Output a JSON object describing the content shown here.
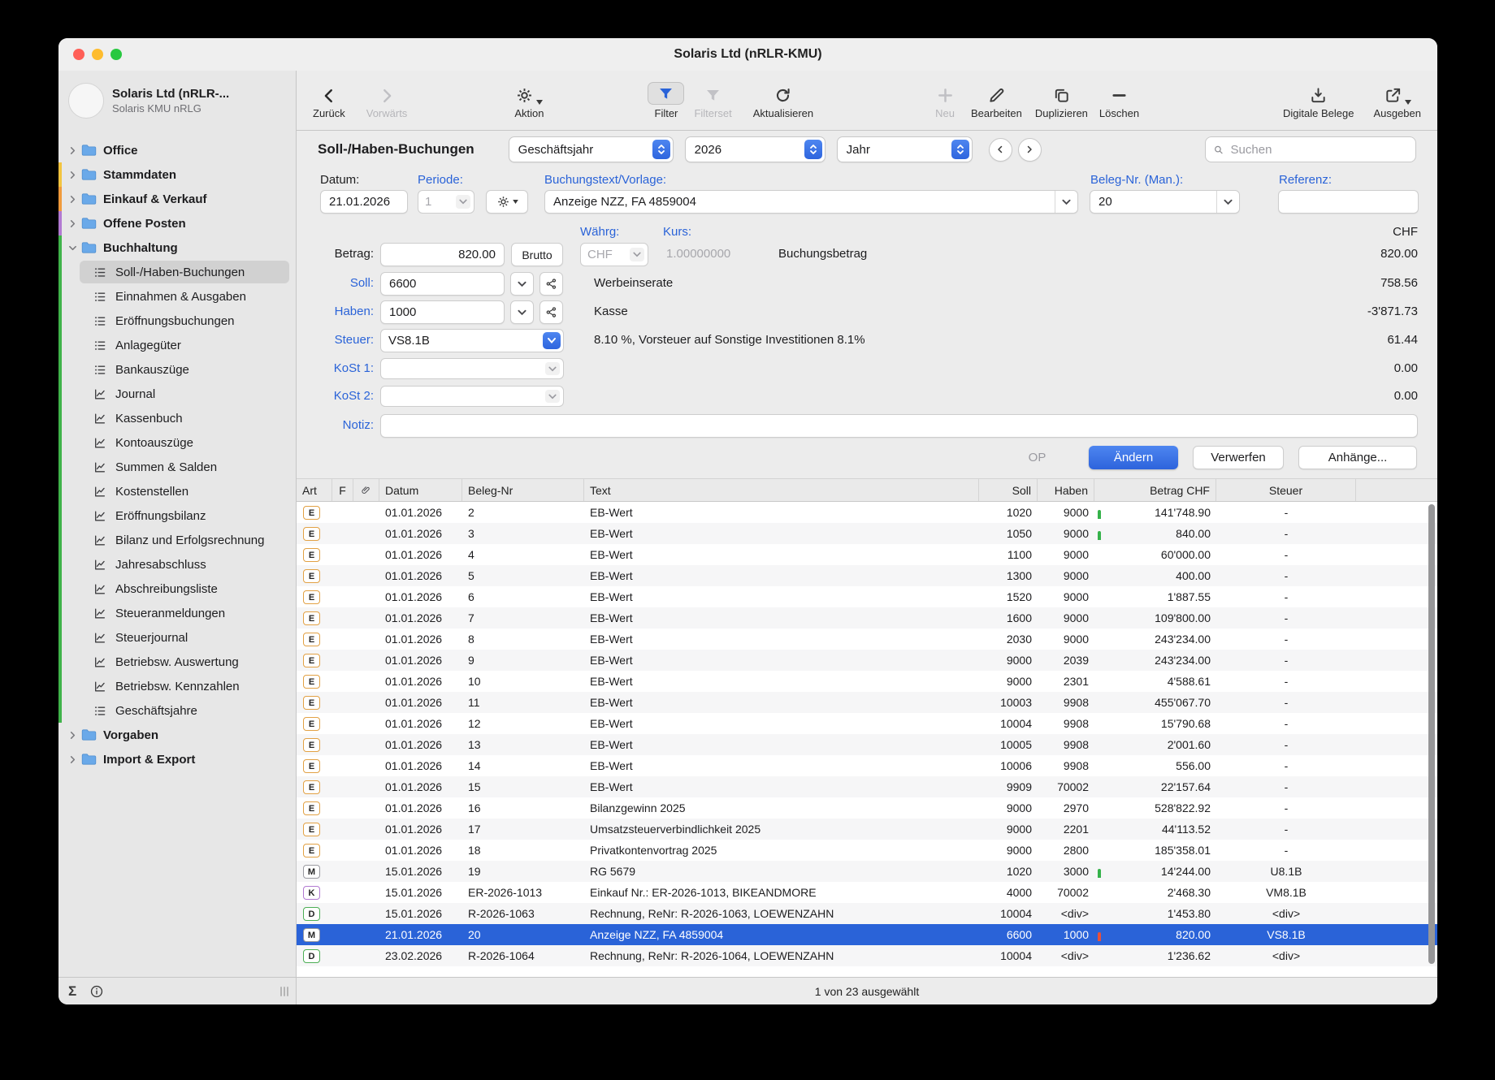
{
  "window": {
    "title": "Solaris Ltd  (nRLR-KMU)"
  },
  "toolbar": {
    "back": "Zurück",
    "forward": "Vorwärts",
    "action": "Aktion",
    "filter": "Filter",
    "filterset": "Filterset",
    "refresh": "Aktualisieren",
    "new": "Neu",
    "edit": "Bearbeiten",
    "duplicate": "Duplizieren",
    "delete": "Löschen",
    "digital_docs": "Digitale Belege",
    "output": "Ausgeben"
  },
  "sidebar": {
    "app_name": "Solaris Ltd  (nRLR-...",
    "app_sub": "Solaris KMU nRLG",
    "footer_sigma": "Σ",
    "tree": [
      {
        "label": "Office",
        "level": 0,
        "icon": "folder",
        "chevron": "r",
        "strip": null,
        "selected": false
      },
      {
        "label": "Stammdaten",
        "level": 0,
        "icon": "folder",
        "chevron": "r",
        "strip": "#f3c43e",
        "selected": false
      },
      {
        "label": "Einkauf & Verkauf",
        "level": 0,
        "icon": "folder",
        "chevron": "r",
        "strip": "#f09a3b",
        "selected": false
      },
      {
        "label": "Offene Posten",
        "level": 0,
        "icon": "folder",
        "chevron": "r",
        "strip": "#b279d2",
        "selected": false
      },
      {
        "label": "Buchhaltung",
        "level": 0,
        "icon": "folder",
        "chevron": "d",
        "strip": "#3fb34a",
        "selected": false
      },
      {
        "label": "Soll-/Haben-Buchungen",
        "level": 1,
        "icon": "list",
        "chevron": null,
        "strip": "#3fb34a",
        "selected": true
      },
      {
        "label": "Einnahmen & Ausgaben",
        "level": 1,
        "icon": "list",
        "chevron": null,
        "strip": "#3fb34a",
        "selected": false
      },
      {
        "label": "Eröffnungsbuchungen",
        "level": 1,
        "icon": "list",
        "chevron": null,
        "strip": "#3fb34a",
        "selected": false
      },
      {
        "label": "Anlagegüter",
        "level": 1,
        "icon": "list",
        "chevron": null,
        "strip": "#3fb34a",
        "selected": false
      },
      {
        "label": "Bankauszüge",
        "level": 1,
        "icon": "list",
        "chevron": null,
        "strip": "#3fb34a",
        "selected": false
      },
      {
        "label": "Journal",
        "level": 1,
        "icon": "chart",
        "chevron": null,
        "strip": "#3fb34a",
        "selected": false
      },
      {
        "label": "Kassenbuch",
        "level": 1,
        "icon": "chart",
        "chevron": null,
        "strip": "#3fb34a",
        "selected": false
      },
      {
        "label": "Kontoauszüge",
        "level": 1,
        "icon": "chart",
        "chevron": null,
        "strip": "#3fb34a",
        "selected": false
      },
      {
        "label": "Summen & Salden",
        "level": 1,
        "icon": "chart",
        "chevron": null,
        "strip": "#3fb34a",
        "selected": false
      },
      {
        "label": "Kostenstellen",
        "level": 1,
        "icon": "chart",
        "chevron": null,
        "strip": "#3fb34a",
        "selected": false
      },
      {
        "label": "Eröffnungsbilanz",
        "level": 1,
        "icon": "chart",
        "chevron": null,
        "strip": "#3fb34a",
        "selected": false
      },
      {
        "label": "Bilanz und Erfolgsrechnung",
        "level": 1,
        "icon": "chart",
        "chevron": null,
        "strip": "#3fb34a",
        "selected": false
      },
      {
        "label": "Jahresabschluss",
        "level": 1,
        "icon": "chart",
        "chevron": null,
        "strip": "#3fb34a",
        "selected": false
      },
      {
        "label": "Abschreibungsliste",
        "level": 1,
        "icon": "chart",
        "chevron": null,
        "strip": "#3fb34a",
        "selected": false
      },
      {
        "label": "Steueranmeldungen",
        "level": 1,
        "icon": "chart",
        "chevron": null,
        "strip": "#3fb34a",
        "selected": false
      },
      {
        "label": "Steuerjournal",
        "level": 1,
        "icon": "chart",
        "chevron": null,
        "strip": "#3fb34a",
        "selected": false
      },
      {
        "label": "Betriebsw. Auswertung",
        "level": 1,
        "icon": "chart",
        "chevron": null,
        "strip": "#3fb34a",
        "selected": false
      },
      {
        "label": "Betriebsw. Kennzahlen",
        "level": 1,
        "icon": "chart",
        "chevron": null,
        "strip": "#3fb34a",
        "selected": false
      },
      {
        "label": "Geschäftsjahre",
        "level": 1,
        "icon": "list",
        "chevron": null,
        "strip": "#3fb34a",
        "selected": false
      },
      {
        "label": "Vorgaben",
        "level": 0,
        "icon": "folder",
        "chevron": "r",
        "strip": null,
        "selected": false
      },
      {
        "label": "Import & Export",
        "level": 0,
        "icon": "folder",
        "chevron": "r",
        "strip": null,
        "selected": false
      }
    ]
  },
  "view_header": {
    "title": "Soll-/Haben-Buchungen",
    "fiscal_year_label": "Geschäftsjahr",
    "year_value": "2026",
    "period_value": "Jahr",
    "search_placeholder": "Suchen"
  },
  "form": {
    "datum_label": "Datum:",
    "datum_value": "21.01.2026",
    "periode_label": "Periode:",
    "periode_value": "1",
    "buchungstext_label": "Buchungstext/Vorlage:",
    "buchungstext_value": "Anzeige NZZ, FA 4859004",
    "beleg_label": "Beleg-Nr. (Man.):",
    "beleg_value": "20",
    "referenz_label": "Referenz:",
    "referenz_value": "",
    "waehrg_label": "Währg:",
    "waehrg_value": "CHF",
    "kurs_label": "Kurs:",
    "kurs_value": "1.00000000",
    "currency_right": "CHF",
    "betrag_label": "Betrag:",
    "betrag_value": "820.00",
    "brutto_label": "Brutto",
    "buchungsbetrag_text": "Buchungsbetrag",
    "betrag_right": "820.00",
    "soll_label": "Soll:",
    "soll_value": "6600",
    "soll_text": "Werbeinserate",
    "soll_right": "758.56",
    "haben_label": "Haben:",
    "haben_value": "1000",
    "haben_text": "Kasse",
    "haben_right": "-3'871.73",
    "steuer_label": "Steuer:",
    "steuer_value": "VS8.1B",
    "steuer_text": "8.10 %, Vorsteuer auf Sonstige Investitionen 8.1%",
    "steuer_right": "61.44",
    "kost1_label": "KoSt 1:",
    "kost1_right": "0.00",
    "kost2_label": "KoSt 2:",
    "kost2_right": "0.00",
    "notiz_label": "Notiz:",
    "notiz_value": "",
    "buttons": {
      "op": "OP",
      "aendern": "Ändern",
      "verwerfen": "Verwerfen",
      "anhaenge": "Anhänge..."
    }
  },
  "table": {
    "headers": [
      "Art",
      "F",
      "",
      "Datum",
      "Beleg-Nr",
      "Text",
      "Soll",
      "Haben",
      "Betrag CHF",
      "Steuer"
    ],
    "art_colors": {
      "E": "#e2a144",
      "M": "#9a9aa0",
      "K": "#b279d2",
      "D": "#4cae54"
    },
    "indicator_colors": {
      "green": "#35b24a",
      "red": "#e8503a"
    },
    "rows": [
      {
        "art": "E",
        "datum": "01.01.2026",
        "beleg": "2",
        "text": "EB-Wert",
        "soll": "1020",
        "haben": "9000",
        "betrag": "141'748.90",
        "steuer": "-",
        "indicator": "green",
        "selected": false
      },
      {
        "art": "E",
        "datum": "01.01.2026",
        "beleg": "3",
        "text": "EB-Wert",
        "soll": "1050",
        "haben": "9000",
        "betrag": "840.00",
        "steuer": "-",
        "indicator": "green",
        "selected": false
      },
      {
        "art": "E",
        "datum": "01.01.2026",
        "beleg": "4",
        "text": "EB-Wert",
        "soll": "1100",
        "haben": "9000",
        "betrag": "60'000.00",
        "steuer": "-",
        "indicator": null,
        "selected": false
      },
      {
        "art": "E",
        "datum": "01.01.2026",
        "beleg": "5",
        "text": "EB-Wert",
        "soll": "1300",
        "haben": "9000",
        "betrag": "400.00",
        "steuer": "-",
        "indicator": null,
        "selected": false
      },
      {
        "art": "E",
        "datum": "01.01.2026",
        "beleg": "6",
        "text": "EB-Wert",
        "soll": "1520",
        "haben": "9000",
        "betrag": "1'887.55",
        "steuer": "-",
        "indicator": null,
        "selected": false
      },
      {
        "art": "E",
        "datum": "01.01.2026",
        "beleg": "7",
        "text": "EB-Wert",
        "soll": "1600",
        "haben": "9000",
        "betrag": "109'800.00",
        "steuer": "-",
        "indicator": null,
        "selected": false
      },
      {
        "art": "E",
        "datum": "01.01.2026",
        "beleg": "8",
        "text": "EB-Wert",
        "soll": "2030",
        "haben": "9000",
        "betrag": "243'234.00",
        "steuer": "-",
        "indicator": null,
        "selected": false
      },
      {
        "art": "E",
        "datum": "01.01.2026",
        "beleg": "9",
        "text": "EB-Wert",
        "soll": "9000",
        "haben": "2039",
        "betrag": "243'234.00",
        "steuer": "-",
        "indicator": null,
        "selected": false
      },
      {
        "art": "E",
        "datum": "01.01.2026",
        "beleg": "10",
        "text": "EB-Wert",
        "soll": "9000",
        "haben": "2301",
        "betrag": "4'588.61",
        "steuer": "-",
        "indicator": null,
        "selected": false
      },
      {
        "art": "E",
        "datum": "01.01.2026",
        "beleg": "11",
        "text": "EB-Wert",
        "soll": "10003",
        "haben": "9908",
        "betrag": "455'067.70",
        "steuer": "-",
        "indicator": null,
        "selected": false
      },
      {
        "art": "E",
        "datum": "01.01.2026",
        "beleg": "12",
        "text": "EB-Wert",
        "soll": "10004",
        "haben": "9908",
        "betrag": "15'790.68",
        "steuer": "-",
        "indicator": null,
        "selected": false
      },
      {
        "art": "E",
        "datum": "01.01.2026",
        "beleg": "13",
        "text": "EB-Wert",
        "soll": "10005",
        "haben": "9908",
        "betrag": "2'001.60",
        "steuer": "-",
        "indicator": null,
        "selected": false
      },
      {
        "art": "E",
        "datum": "01.01.2026",
        "beleg": "14",
        "text": "EB-Wert",
        "soll": "10006",
        "haben": "9908",
        "betrag": "556.00",
        "steuer": "-",
        "indicator": null,
        "selected": false
      },
      {
        "art": "E",
        "datum": "01.01.2026",
        "beleg": "15",
        "text": "EB-Wert",
        "soll": "9909",
        "haben": "70002",
        "betrag": "22'157.64",
        "steuer": "-",
        "indicator": null,
        "selected": false
      },
      {
        "art": "E",
        "datum": "01.01.2026",
        "beleg": "16",
        "text": "Bilanzgewinn 2025",
        "soll": "9000",
        "haben": "2970",
        "betrag": "528'822.92",
        "steuer": "-",
        "indicator": null,
        "selected": false
      },
      {
        "art": "E",
        "datum": "01.01.2026",
        "beleg": "17",
        "text": "Umsatzsteuerverbindlichkeit 2025",
        "soll": "9000",
        "haben": "2201",
        "betrag": "44'113.52",
        "steuer": "-",
        "indicator": null,
        "selected": false
      },
      {
        "art": "E",
        "datum": "01.01.2026",
        "beleg": "18",
        "text": "Privatkontenvortrag 2025",
        "soll": "9000",
        "haben": "2800",
        "betrag": "185'358.01",
        "steuer": "-",
        "indicator": null,
        "selected": false
      },
      {
        "art": "M",
        "datum": "15.01.2026",
        "beleg": "19",
        "text": "RG 5679",
        "soll": "1020",
        "haben": "3000",
        "betrag": "14'244.00",
        "steuer": "U8.1B",
        "indicator": "green",
        "selected": false
      },
      {
        "art": "K",
        "datum": "15.01.2026",
        "beleg": "ER-2026-1013",
        "text": "Einkauf Nr.: ER-2026-1013, BIKEANDMORE",
        "soll": "4000",
        "haben": "70002",
        "betrag": "2'468.30",
        "steuer": "VM8.1B",
        "indicator": null,
        "selected": false
      },
      {
        "art": "D",
        "datum": "15.01.2026",
        "beleg": "R-2026-1063",
        "text": "Rechnung, ReNr: R-2026-1063, LOEWENZAHN",
        "soll": "10004",
        "haben": "<div>",
        "betrag": "1'453.80",
        "steuer": "<div>",
        "indicator": null,
        "selected": false
      },
      {
        "art": "M",
        "datum": "21.01.2026",
        "beleg": "20",
        "text": "Anzeige NZZ, FA 4859004",
        "soll": "6600",
        "haben": "1000",
        "betrag": "820.00",
        "steuer": "VS8.1B",
        "indicator": "red",
        "selected": true
      },
      {
        "art": "D",
        "datum": "23.02.2026",
        "beleg": "R-2026-1064",
        "text": "Rechnung, ReNr: R-2026-1064, LOEWENZAHN",
        "soll": "10004",
        "haben": "<div>",
        "betrag": "1'236.62",
        "steuer": "<div>",
        "indicator": null,
        "selected": false
      }
    ]
  },
  "statusbar": {
    "text": "1 von 23 ausgewählt"
  }
}
